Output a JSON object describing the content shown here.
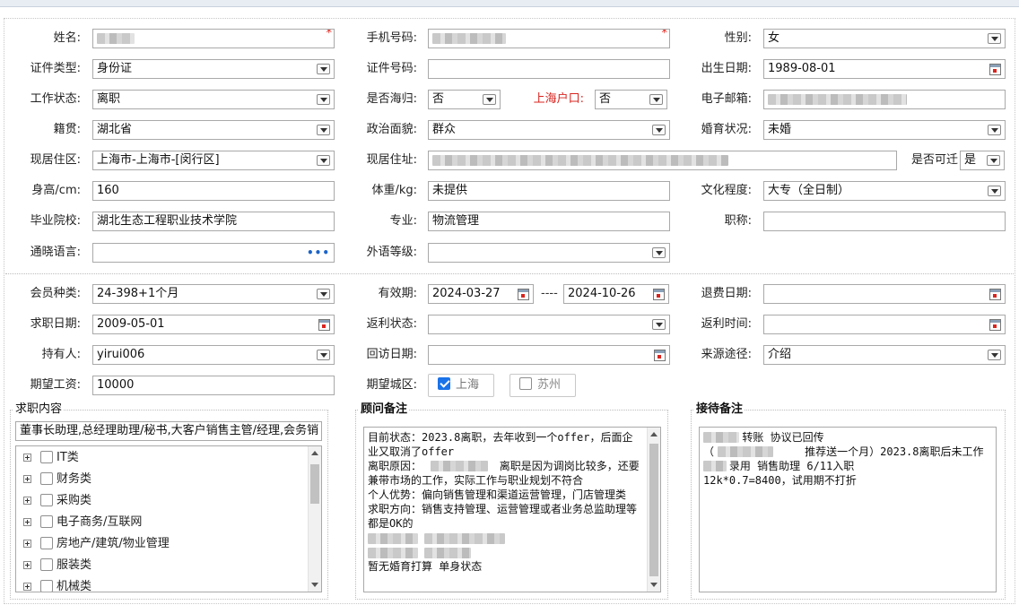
{
  "form": {
    "name": {
      "label": "姓名:",
      "value": ""
    },
    "phone": {
      "label": "手机号码:",
      "value": ""
    },
    "gender": {
      "label": "性别:",
      "value": "女"
    },
    "id_type": {
      "label": "证件类型:",
      "value": "身份证"
    },
    "id_number": {
      "label": "证件号码:",
      "value": ""
    },
    "birth_date": {
      "label": "出生日期:",
      "value": "1989-08-01"
    },
    "work_status": {
      "label": "工作状态:",
      "value": "离职"
    },
    "returnee": {
      "label": "是否海归:",
      "value": "否"
    },
    "shanghai_hukou": {
      "label": "上海户口:",
      "value": "否"
    },
    "email": {
      "label": "电子邮箱:",
      "value": ""
    },
    "native_place": {
      "label": "籍贯:",
      "value": "湖北省"
    },
    "political_status": {
      "label": "政治面貌:",
      "value": "群众"
    },
    "marital_status": {
      "label": "婚育状况:",
      "value": "未婚"
    },
    "current_area": {
      "label": "现居住区:",
      "value": "上海市-上海市-[闵行区]"
    },
    "current_address": {
      "label": "现居住址:",
      "value": ""
    },
    "relocate": {
      "label": "是否可迁",
      "value": "是"
    },
    "height": {
      "label": "身高/cm:",
      "value": "160"
    },
    "weight": {
      "label": "体重/kg:",
      "value": "未提供"
    },
    "education": {
      "label": "文化程度:",
      "value": "大专（全日制）"
    },
    "school": {
      "label": "毕业院校:",
      "value": "湖北生态工程职业技术学院"
    },
    "major": {
      "label": "专业:",
      "value": "物流管理"
    },
    "title": {
      "label": "职称:",
      "value": ""
    },
    "languages": {
      "label": "通晓语言:",
      "value": "",
      "more": "•••"
    },
    "foreign_level": {
      "label": "外语等级:",
      "value": ""
    },
    "member_type": {
      "label": "会员种类:",
      "value": "24-398+1个月"
    },
    "valid_period": {
      "label": "有效期:",
      "start": "2024-03-27",
      "separator": "----",
      "end": "2024-10-26"
    },
    "refund_date": {
      "label": "退费日期:",
      "value": ""
    },
    "job_seek_date": {
      "label": "求职日期:",
      "value": "2009-05-01"
    },
    "rebate_status": {
      "label": "返利状态:",
      "value": ""
    },
    "rebate_time": {
      "label": "返利时间:",
      "value": ""
    },
    "holder": {
      "label": "持有人:",
      "value": "yirui006"
    },
    "revisit_date": {
      "label": "回访日期:",
      "value": ""
    },
    "source": {
      "label": "来源途径:",
      "value": "介绍"
    },
    "expected_salary": {
      "label": "期望工资:",
      "value": "10000"
    },
    "expected_city": {
      "label": "期望城区:",
      "options": [
        {
          "label": "上海",
          "checked": true
        },
        {
          "label": "苏州",
          "checked": false
        }
      ]
    }
  },
  "job_content": {
    "title": "求职内容",
    "summary": "董事长助理,总经理助理/秘书,大客户销售主管/经理,会务销",
    "tree": [
      "IT类",
      "财务类",
      "采购类",
      "电子商务/互联网",
      "房地产/建筑/物业管理",
      "服装类",
      "机械类"
    ]
  },
  "consultant_notes": {
    "title": "顾问备注",
    "lines": [
      "目前状态：2023.8离职，去年收到一个offer，后面企业又取消了offer",
      "离职原因：            离职是因为调岗比较多，还要兼带市场的工作，实际工作与职业规划不符合",
      "个人优势：偏向销售管理和渠道运营管理，门店管理类",
      "求职方向：销售支持管理、运营管理或者业务总监助理等都是OK的",
      "",
      "",
      "暂无婚育打算 单身状态"
    ]
  },
  "reception_notes": {
    "title": "接待备注",
    "lines": [
      "      转账 协议已回传",
      "（              推荐送一个月）2023.8离职后未工作",
      "",
      "",
      "    录用 销售助理 6/11入职",
      "12k*0.7=8400，试用期不打折"
    ]
  }
}
